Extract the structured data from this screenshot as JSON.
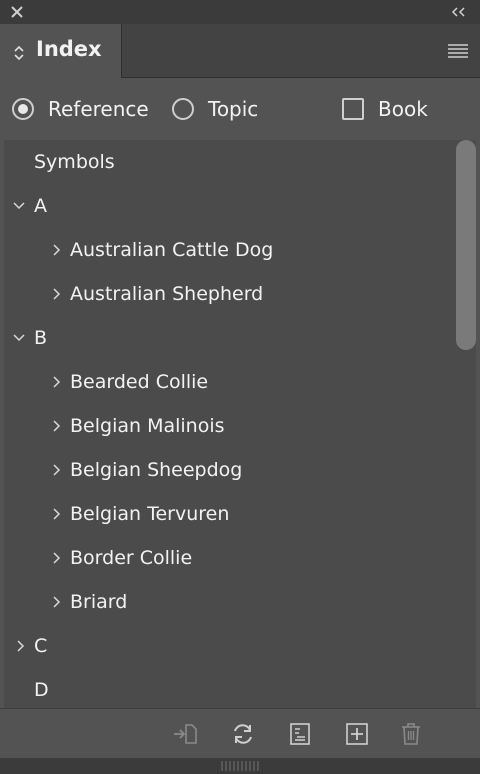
{
  "panel": {
    "tab_label": "Index"
  },
  "options": {
    "reference_label": "Reference",
    "topic_label": "Topic",
    "book_label": "Book",
    "selected": "reference",
    "book_checked": false
  },
  "list": {
    "rows": [
      {
        "label": "Symbols",
        "level": 0,
        "chevron": "none"
      },
      {
        "label": "A",
        "level": 0,
        "chevron": "down"
      },
      {
        "label": "Australian Cattle Dog",
        "level": 1,
        "chevron": "right"
      },
      {
        "label": "Australian Shepherd",
        "level": 1,
        "chevron": "right"
      },
      {
        "label": "B",
        "level": 0,
        "chevron": "down"
      },
      {
        "label": "Bearded Collie",
        "level": 1,
        "chevron": "right"
      },
      {
        "label": "Belgian Malinois",
        "level": 1,
        "chevron": "right"
      },
      {
        "label": "Belgian Sheepdog",
        "level": 1,
        "chevron": "right"
      },
      {
        "label": "Belgian Tervuren",
        "level": 1,
        "chevron": "right"
      },
      {
        "label": "Border Collie",
        "level": 1,
        "chevron": "right"
      },
      {
        "label": "Briard",
        "level": 1,
        "chevron": "right"
      },
      {
        "label": "C",
        "level": 0,
        "chevron": "right"
      },
      {
        "label": "D",
        "level": 0,
        "chevron": "none"
      }
    ]
  },
  "icons": {
    "close": "close-icon",
    "collapse": "double-chevron-left-icon",
    "tab_arrows": "updown-arrows-icon",
    "menu": "hamburger-menu-icon",
    "go_to_entry": "go-to-selected-marker-icon",
    "update": "refresh-icon",
    "create_index": "generate-index-icon",
    "new_entry": "new-entry-icon",
    "delete": "trash-icon"
  },
  "colors": {
    "panel_bg": "#535353",
    "list_bg": "#4b4b4b",
    "title_bg": "#3b3b3b",
    "text": "#f2f2f2"
  }
}
